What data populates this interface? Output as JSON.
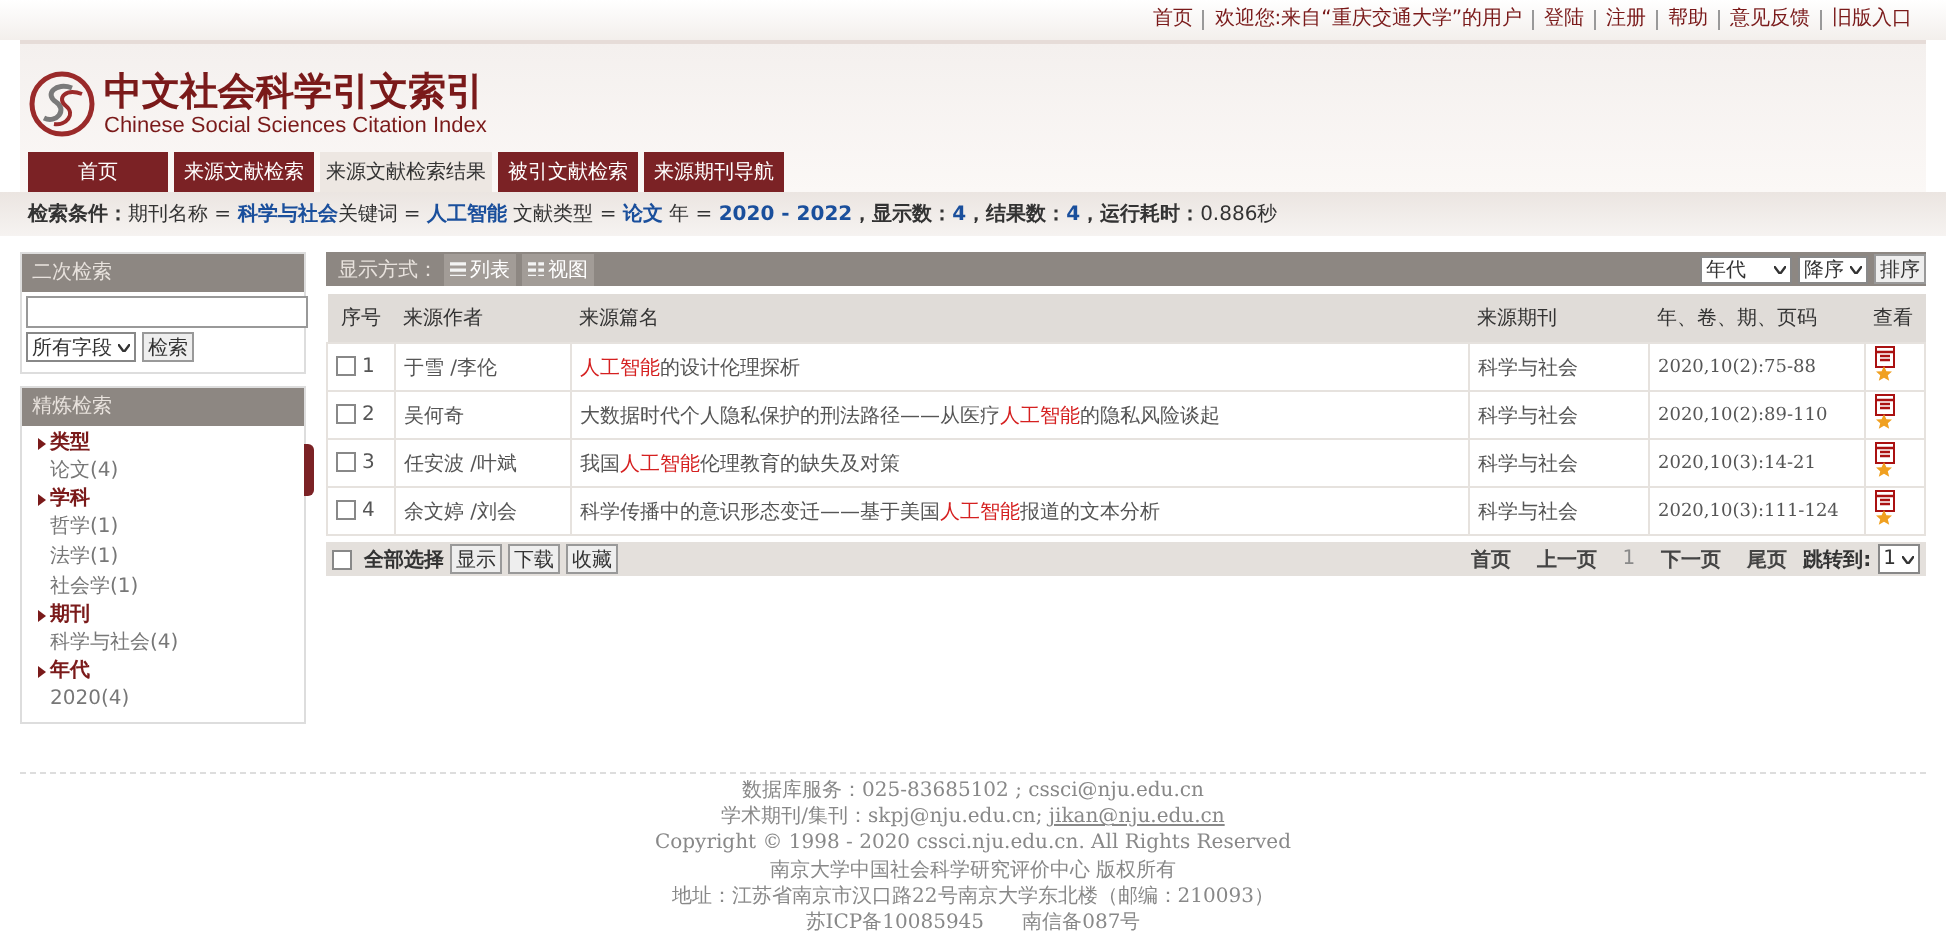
{
  "top_links": [
    "首页",
    "欢迎您:来自“重庆交通大学”的用户",
    "登陆",
    "注册",
    "帮助",
    "意见反馈",
    "旧版入口"
  ],
  "logo": {
    "title": "中文社会科学引文索引",
    "subtitle": "Chinese Social Sciences Citation Index"
  },
  "tabs": [
    {
      "label": "首页",
      "selected": false
    },
    {
      "label": "来源文献检索",
      "selected": false
    },
    {
      "label": "来源文献检索结果",
      "selected": true
    },
    {
      "label": "被引文献检索",
      "selected": false
    },
    {
      "label": "来源期刊导航",
      "selected": false
    }
  ],
  "search_condition": [
    {
      "kind": "label",
      "text": "检索条件："
    },
    {
      "kind": "text",
      "text": "期刊名称 = "
    },
    {
      "kind": "value",
      "text": "科学与社会"
    },
    {
      "kind": "text",
      "text": "关键词 = "
    },
    {
      "kind": "value",
      "text": "人工智能"
    },
    {
      "kind": "text",
      "text": " 文献类型 = "
    },
    {
      "kind": "value",
      "text": "论文"
    },
    {
      "kind": "text",
      "text": " 年 = "
    },
    {
      "kind": "value",
      "text": "2020 - 2022"
    },
    {
      "kind": "label",
      "text": "，显示数："
    },
    {
      "kind": "value",
      "text": "4"
    },
    {
      "kind": "label",
      "text": "，结果数："
    },
    {
      "kind": "value",
      "text": "4"
    },
    {
      "kind": "label",
      "text": "，运行耗时："
    },
    {
      "kind": "text",
      "text": "0.886秒"
    }
  ],
  "secondary_search": {
    "title": "二次检索",
    "field": "所有字段",
    "button": "检索"
  },
  "refine": {
    "title": "精炼检索",
    "groups": [
      {
        "label": "类型",
        "items": [
          "论文(4)"
        ]
      },
      {
        "label": "学科",
        "items": [
          "哲学(1)",
          "法学(1)",
          "社会学(1)"
        ]
      },
      {
        "label": "期刊",
        "items": [
          "科学与社会(4)"
        ]
      },
      {
        "label": "年代",
        "items": [
          "2020(4)"
        ]
      }
    ]
  },
  "toolbar": {
    "label": "显示方式：",
    "views": [
      "列表",
      "视图"
    ],
    "sort_field": "年代",
    "sort_order": "降序",
    "sort_button": "排序"
  },
  "table": {
    "columns": [
      "序号",
      "来源作者",
      "来源篇名",
      "来源期刊",
      "年、卷、期、页码",
      "查看"
    ],
    "rows": [
      {
        "checked": false,
        "number": "1",
        "author": "于雪 /李伦",
        "title": "**人工智能**的设计伦理探析",
        "journal": "科学与社会",
        "citation": "2020,10(2):75-88"
      },
      {
        "checked": false,
        "number": "2",
        "author": "吴何奇",
        "title": "大数据时代个人隐私保护的刑法路径——从医疗**人工智能**的隐私风险谈起",
        "journal": "科学与社会",
        "citation": "2020,10(2):89-110"
      },
      {
        "checked": false,
        "number": "3",
        "author": "任安波 /叶斌",
        "title": "我国**人工智能**伦理教育的缺失及对策",
        "journal": "科学与社会",
        "citation": "2020,10(3):14-21"
      },
      {
        "checked": false,
        "number": "4",
        "author": "余文婷 /刘会",
        "title": "科学传播中的意识形态变迁——基于美国**人工智能**报道的文本分析",
        "journal": "科学与社会",
        "citation": "2020,10(3):111-124"
      }
    ]
  },
  "bottom_bar": {
    "select_all": {
      "label": "全部选择",
      "checked": false
    },
    "buttons": [
      "显示",
      "下载",
      "收藏"
    ],
    "pager": [
      {
        "label": "首页",
        "current": false
      },
      {
        "label": "上一页",
        "current": false
      },
      {
        "label": "1",
        "current": true
      },
      {
        "label": "下一页",
        "current": false
      },
      {
        "label": "尾页",
        "current": false
      }
    ],
    "jump_label": "跳转到:",
    "jump_page": "1"
  },
  "footer": [
    "数据库服务：025-83685102 ; cssci@nju.edu.cn",
    "学术期刊/集刊：skpj@nju.edu.cn;",
    "jikan@nju.edu.cn",
    "Copyright © 1998 - 2020 cssci.nju.edu.cn. All Rights Reserved",
    "南京大学中国社会科学研究评价中心 版权所有",
    "地址：江苏省南京市汉口路22号南京大学东北楼（邮编：210093）",
    "苏ICP备10085945",
    "南信备087号"
  ]
}
